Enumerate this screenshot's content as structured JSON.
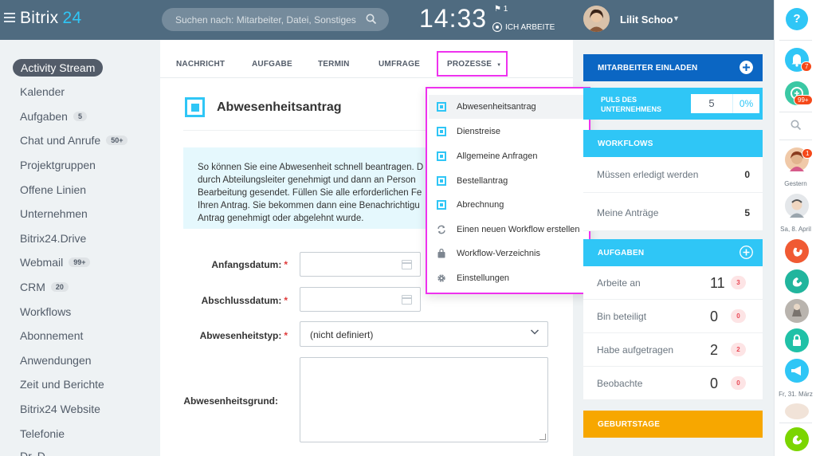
{
  "header": {
    "logo_main": "Bitrix",
    "logo_num": "24",
    "search_placeholder": "Suchen nach: Mitarbeiter, Datei, Sonstiges",
    "clock": "14:33",
    "flag_count": "1",
    "work_status": "ICH ARBEITE",
    "user_name": "Lilit Schoo"
  },
  "rightbar": {
    "help_label": "?",
    "notifications_badge": "7",
    "pulse_badge": "99+",
    "contact_badge": "1",
    "date_yesterday": "Gestern",
    "date_april": "Sa, 8. April",
    "date_march": "Fr, 31. März"
  },
  "sidebar": {
    "items": [
      {
        "label": "Activity Stream",
        "counter": ""
      },
      {
        "label": "Kalender",
        "counter": ""
      },
      {
        "label": "Aufgaben",
        "counter": "5"
      },
      {
        "label": "Chat und Anrufe",
        "counter": "50+"
      },
      {
        "label": "Projektgruppen",
        "counter": ""
      },
      {
        "label": "Offene Linien",
        "counter": ""
      },
      {
        "label": "Unternehmen",
        "counter": ""
      },
      {
        "label": "Bitrix24.Drive",
        "counter": ""
      },
      {
        "label": "Webmail",
        "counter": "99+"
      },
      {
        "label": "CRM",
        "counter": "20"
      },
      {
        "label": "Workflows",
        "counter": ""
      },
      {
        "label": "Abonnement",
        "counter": ""
      },
      {
        "label": "Anwendungen",
        "counter": ""
      },
      {
        "label": "Zeit und Berichte",
        "counter": ""
      },
      {
        "label": "Bitrix24 Website",
        "counter": ""
      },
      {
        "label": "Telefonie",
        "counter": ""
      },
      {
        "label": "Dr. D.",
        "counter": ""
      }
    ]
  },
  "tabs": [
    "NACHRICHT",
    "AUFGABE",
    "TERMIN",
    "UMFRAGE",
    "PROZESSE"
  ],
  "form": {
    "title": "Abwesenheitsantrag",
    "info": "So können Sie eine Abwesenheit schnell beantragen. D\ndurch Abteilungsleiter genehmigt und dann an Person\nBearbeitung gesendet. Füllen Sie alle erforderlichen Fe\nIhren Antrag. Sie bekommen dann eine Benachrichtigu\nAntrag genehmigt oder abgelehnt wurde.",
    "start_label": "Anfangsdatum:",
    "end_label": "Abschlussdatum:",
    "type_label": "Abwesenheitstyp:",
    "type_value": "(nicht definiert)",
    "reason_label": "Abwesenheitsgrund:",
    "required_mark": "*"
  },
  "popup": {
    "items": [
      {
        "label": "Abwesenheitsantrag",
        "icon": "process-icon"
      },
      {
        "label": "Dienstreise",
        "icon": "process-icon"
      },
      {
        "label": "Allgemeine Anfragen",
        "icon": "process-icon"
      },
      {
        "label": "Bestellantrag",
        "icon": "process-icon"
      },
      {
        "label": "Abrechnung",
        "icon": "process-icon"
      },
      {
        "label": "Einen neuen Workflow erstellen",
        "icon": "cycle-icon"
      },
      {
        "label": "Workflow-Verzeichnis",
        "icon": "bag-icon"
      },
      {
        "label": "Einstellungen",
        "icon": "gear-icon"
      }
    ]
  },
  "widgets": {
    "invite": "MITARBEITER EINLADEN",
    "pulse": "PULS DES UNTERNEHMENS",
    "pulse_value": "5",
    "pulse_percent": "0%",
    "workflows": "WORKFLOWS",
    "wf_rows": [
      {
        "label": "Müssen erledigt werden",
        "value": "0"
      },
      {
        "label": "Meine Anträge",
        "value": "5"
      }
    ],
    "tasks": "AUFGABEN",
    "task_rows": [
      {
        "label": "Arbeite an",
        "value": "11",
        "count": "3"
      },
      {
        "label": "Bin beteiligt",
        "value": "0",
        "count": "0"
      },
      {
        "label": "Habe aufgetragen",
        "value": "2",
        "count": "2"
      },
      {
        "label": "Beobachte",
        "value": "0",
        "count": "0"
      }
    ],
    "birthdays": "GEBURTSTAGE"
  },
  "colors": {
    "header_bg": "#4f6b80",
    "accent_blue": "#2fc6f6",
    "invite_blue": "#0b66c3",
    "highlight_magenta": "#ee32ee",
    "birthday_orange": "#f7a700"
  }
}
